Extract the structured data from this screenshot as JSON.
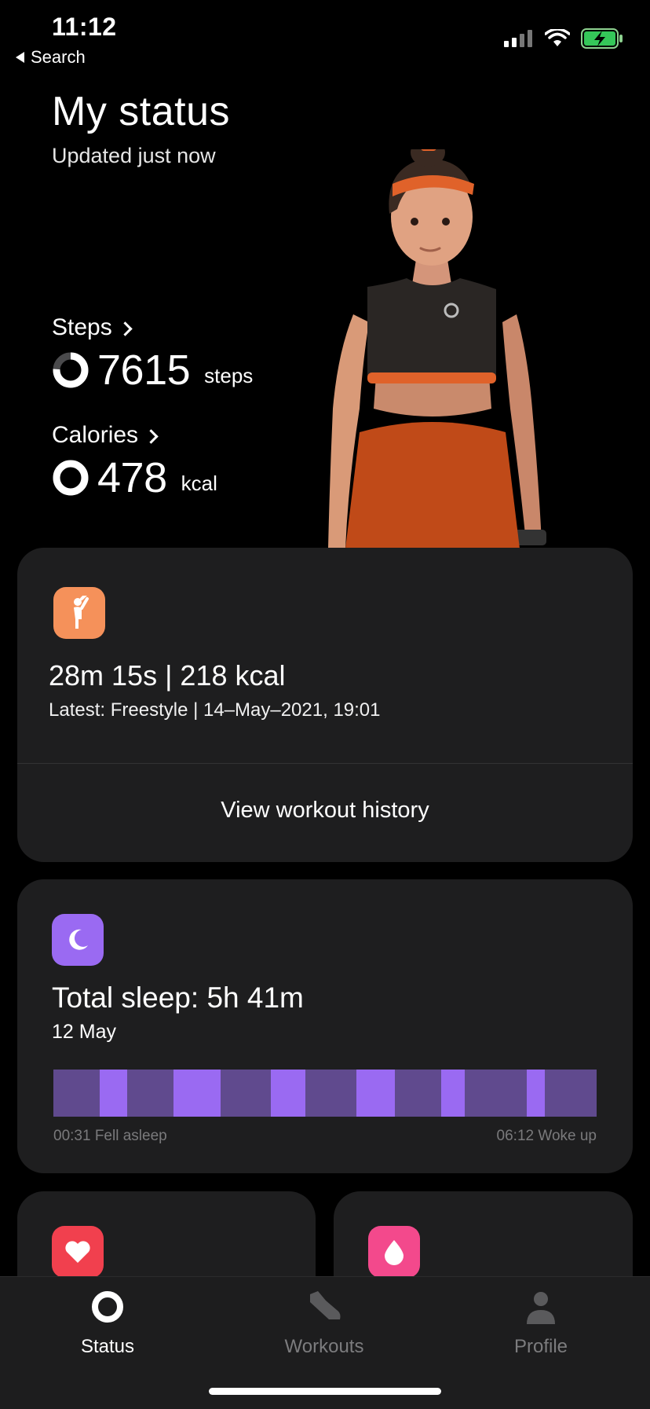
{
  "status_bar": {
    "time": "11:12",
    "back_label": "Search"
  },
  "header": {
    "title": "My status",
    "subtitle": "Updated just now"
  },
  "metrics": {
    "steps": {
      "label": "Steps",
      "value": "7615",
      "unit": "steps",
      "progress": 0.76
    },
    "calories": {
      "label": "Calories",
      "value": "478",
      "unit": "kcal",
      "progress": 1.0
    }
  },
  "workout": {
    "icon": "freestyle-workout-icon",
    "summary": "28m 15s | 218 kcal",
    "latest": "Latest: Freestyle | 14–May–2021, 19:01",
    "history_link": "View workout history",
    "accent": "#f5915a"
  },
  "sleep": {
    "icon": "moon-icon",
    "title": "Total sleep: 5h 41m",
    "date": "12 May",
    "start_label": "00:31 Fell asleep",
    "end_label": "06:12 Woke up",
    "accent": "#9a6af2",
    "segments": [
      {
        "type": "deep",
        "weight": 6
      },
      {
        "type": "light",
        "weight": 3.5
      },
      {
        "type": "deep",
        "weight": 6
      },
      {
        "type": "light",
        "weight": 6
      },
      {
        "type": "deep",
        "weight": 6.5
      },
      {
        "type": "light",
        "weight": 4.5
      },
      {
        "type": "deep",
        "weight": 6.5
      },
      {
        "type": "light",
        "weight": 5
      },
      {
        "type": "deep",
        "weight": 6
      },
      {
        "type": "light",
        "weight": 3
      },
      {
        "type": "deep",
        "weight": 8
      },
      {
        "type": "light",
        "weight": 2.3
      },
      {
        "type": "deep",
        "weight": 6.7
      }
    ]
  },
  "cards_bottom": [
    {
      "icon": "heart-icon",
      "accent": "#f1404e"
    },
    {
      "icon": "drop-icon",
      "accent": "#f3498c"
    }
  ],
  "tabs": [
    {
      "label": "Status",
      "icon": "status-ring-icon",
      "active": true
    },
    {
      "label": "Workouts",
      "icon": "shoe-icon",
      "active": false
    },
    {
      "label": "Profile",
      "icon": "person-icon",
      "active": false
    }
  ]
}
